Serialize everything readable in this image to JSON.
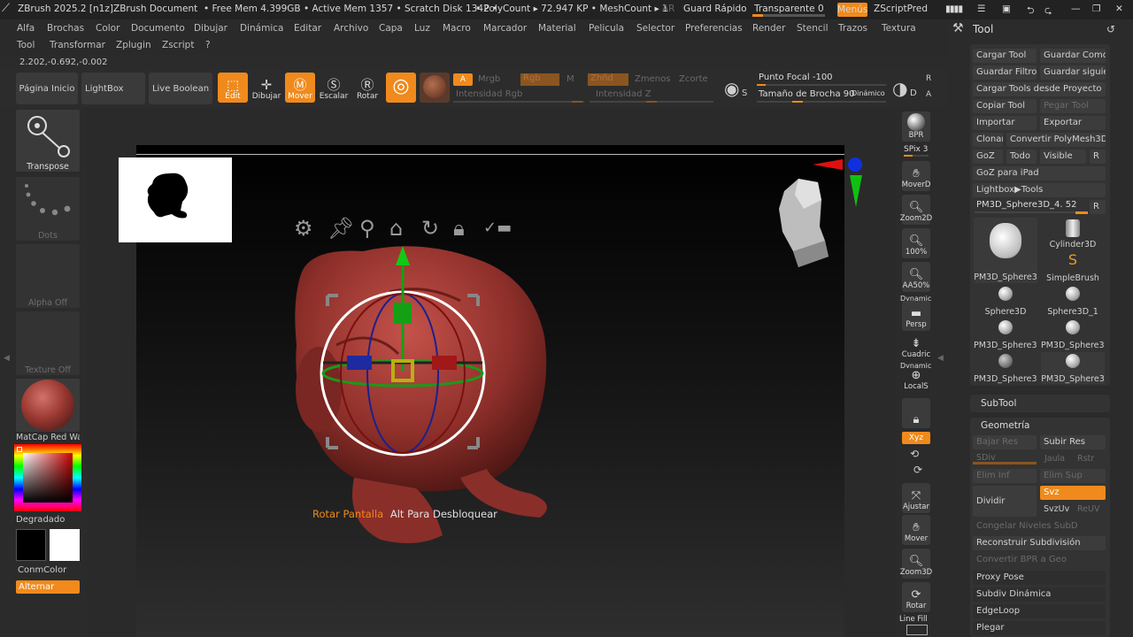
{
  "titlebar": {
    "app": "ZBrush 2025.2 [n1z]",
    "document": "ZBrush Document",
    "stats": "• Free Mem 4.399GB • Active Mem 1357 • Scratch Disk 1342 •",
    "poly": "• PolyCount ▸ 72.947 KP • MeshCount ▸ 1",
    "ar": "AR",
    "guard": "Guard Rápido",
    "transparent": "Transparente 0",
    "menus": "Menús",
    "zscript": "ZScriptPred"
  },
  "menu_row1": [
    "Alfa",
    "Brochas",
    "Color",
    "Documento",
    "Dibujar",
    "Dinámica",
    "Editar",
    "Archivo",
    "Capa",
    "Luz",
    "Macro",
    "Marcador",
    "Material",
    "Pelicula",
    "Selector",
    "Preferencias",
    "Render",
    "Stencil",
    "Trazos",
    "Textura"
  ],
  "menu_row2": [
    "Tool",
    "Transformar",
    "Zplugin",
    "Zscript",
    "?"
  ],
  "coords": "2.202,-0.692,-0.002",
  "shelf": {
    "home": "Página Inicio",
    "lightbox": "LightBox",
    "liveboolean": "Live Boolean",
    "edit": "Edit",
    "draw": "Dibujar",
    "move": "Mover",
    "scale": "Escalar",
    "rotate": "Rotar",
    "a": "A",
    "mrgb": "Mrgb",
    "rgb": "Rgb",
    "m": "M",
    "zadd": "Zhñd",
    "zsub": "Zmenos",
    "zcut": "Zcorte",
    "rgb_intensity": "Intensidad Rgb",
    "z_intensity": "Intensidad Z",
    "focal": "Punto Focal -100",
    "brush_size": "Tamaño de Brocha 90",
    "dynamic": "Dinámico",
    "s": "S",
    "d": "D",
    "r": "R",
    "a2": "A"
  },
  "left": {
    "transpose": "Transpose",
    "dots": "Dots",
    "alpha": "Alpha Off",
    "texture": "Texture Off",
    "matcap": "MatCap Red Wa",
    "gradient": "Degradado",
    "conmcolor": "ConmColor",
    "alternar": "Alternar",
    "colors": {
      "primary": "#000000",
      "secondary": "#ffffff",
      "matcap": "#9c3a33"
    }
  },
  "viewport": {
    "hint_orange": "Rotar Pantalla",
    "hint_white": "Alt Para Desbloquear",
    "gizmo_icons": [
      "gear-icon",
      "pin-icon",
      "location-icon",
      "home-icon",
      "reset-icon",
      "lock-icon",
      "check-minus-icon"
    ]
  },
  "rightstrip": [
    "BPR",
    "SPix 3",
    "MoverD",
    "Zoom2D",
    "100%",
    "AA50%",
    "Persp",
    "Cuadric",
    "LocalS",
    "",
    "Xyz",
    "",
    "",
    "Ajustar",
    "Mover",
    "Zoom3D",
    "Rotar",
    "Line Fill"
  ],
  "rightstrip_labels_top": {
    "dynamic1": "Dynamic",
    "dynamic2": "Dynamic"
  },
  "tool": {
    "header": "Tool",
    "buttons": [
      [
        "Cargar Tool",
        "Guardar Como"
      ],
      [
        "Guardar Filtros",
        "Guardar siguie"
      ],
      [
        "Cargar Tools desde Proyecto"
      ],
      [
        "Copiar Tool",
        "Pegar Tool"
      ],
      [
        "Importar",
        "Exportar"
      ],
      [
        "Clonar",
        "Convertir PolyMesh3D"
      ],
      [
        "GoZ",
        "Todo",
        "Visible",
        "R"
      ],
      [
        "GoZ para iPad"
      ],
      [
        "Lightbox▶Tools"
      ]
    ],
    "current": "PM3D_Sphere3D_4. 52",
    "current_r": "R",
    "thumbs": [
      "PM3D_Sphere3",
      "Cylinder3D",
      "SimpleBrush",
      "Sphere3D",
      "Sphere3D_1",
      "PM3D_Sphere3I",
      "PM3D_Sphere3I",
      "PM3D_Sphere3I",
      "PM3D_Sphere3"
    ],
    "subtool": "SubTool",
    "geometry": "Geometría",
    "geo": {
      "lower_res": "Bajar Res",
      "higher_res": "Subir Res",
      "sdiv": "SDiv",
      "cage": "Jaula",
      "rstr": "Rstr",
      "del_lower": "Elim Inf",
      "del_higher": "Elim Sup",
      "divide": "Dividir",
      "smt": "Svz",
      "suv": "SvzUv",
      "reuv": "ReUV",
      "freeze": "Congelar Niveles SubD",
      "reconstruct": "Reconstruir Subdivisión",
      "convert_bpr": "Convertir BPR a Geo",
      "proxy": "Proxy Pose",
      "dynamic_subdiv": "Subdiv Dinámica",
      "edgeloop": "EdgeLoop",
      "crease": "Plegar"
    }
  }
}
